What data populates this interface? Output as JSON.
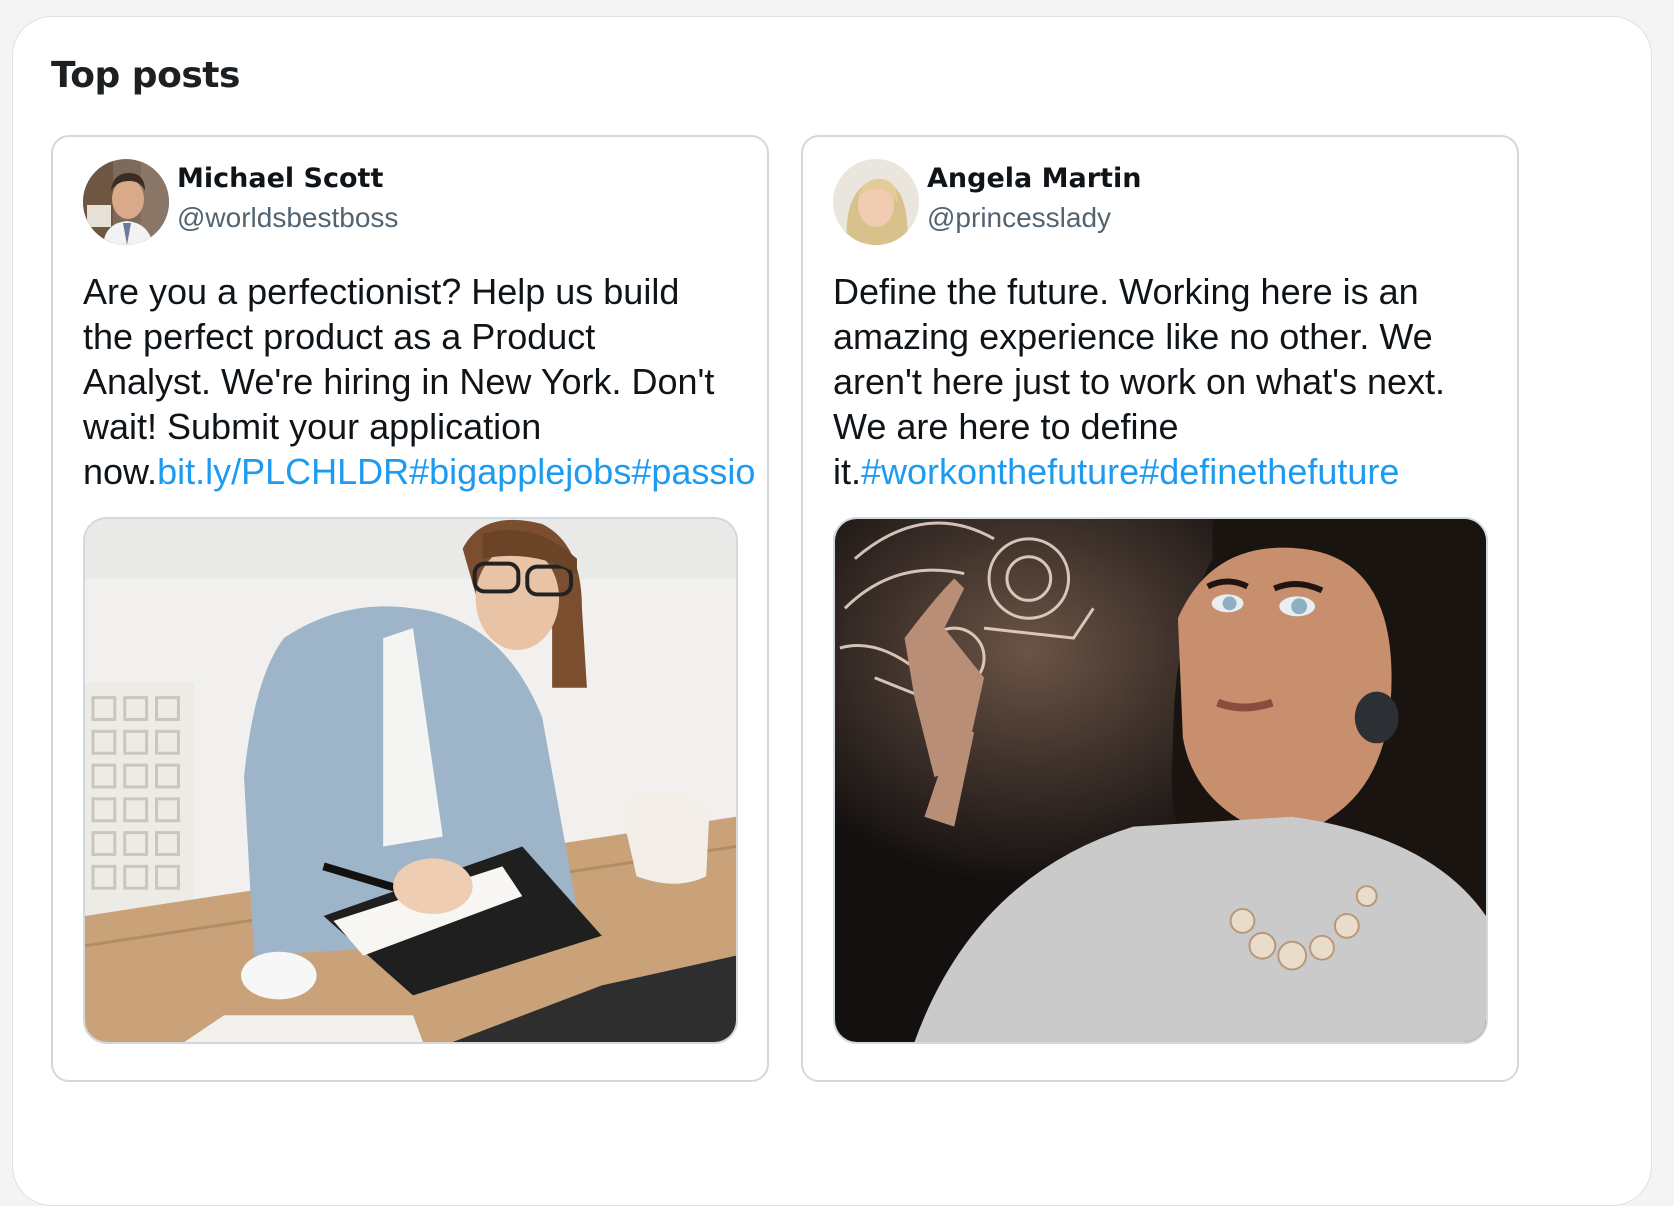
{
  "section": {
    "title": "Top posts"
  },
  "posts": [
    {
      "display_name": "Michael Scott",
      "handle": "@worldsbestboss",
      "text_lines": [
        "Are you a perfectionist? Help us build",
        "the perfect product as a Product",
        "Analyst. We're hiring in New York. Don't",
        "wait! Submit your application"
      ],
      "last_line_plain": "now.",
      "last_line_link": "bit.ly/PLCHLDR#bigapplejobs#passio",
      "avatar_icon": "profile-photo",
      "media_icon": "photo-woman-writing-in-notebook"
    },
    {
      "display_name": "Angela Martin",
      "handle": "@princesslady",
      "text_lines": [
        "Define the future. Working here is an",
        "amazing experience like no other. We",
        "aren't here just to work on what's next.",
        "We are here to define"
      ],
      "last_line_plain": "it.",
      "last_line_link": "#workonthefuture#definethefuture",
      "avatar_icon": "profile-photo",
      "media_icon": "photo-woman-touching-holographic-interface"
    }
  ],
  "colors": {
    "link": "#1d9bf0",
    "text": "#0f1419",
    "muted": "#536471",
    "border": "#cfd9de"
  }
}
